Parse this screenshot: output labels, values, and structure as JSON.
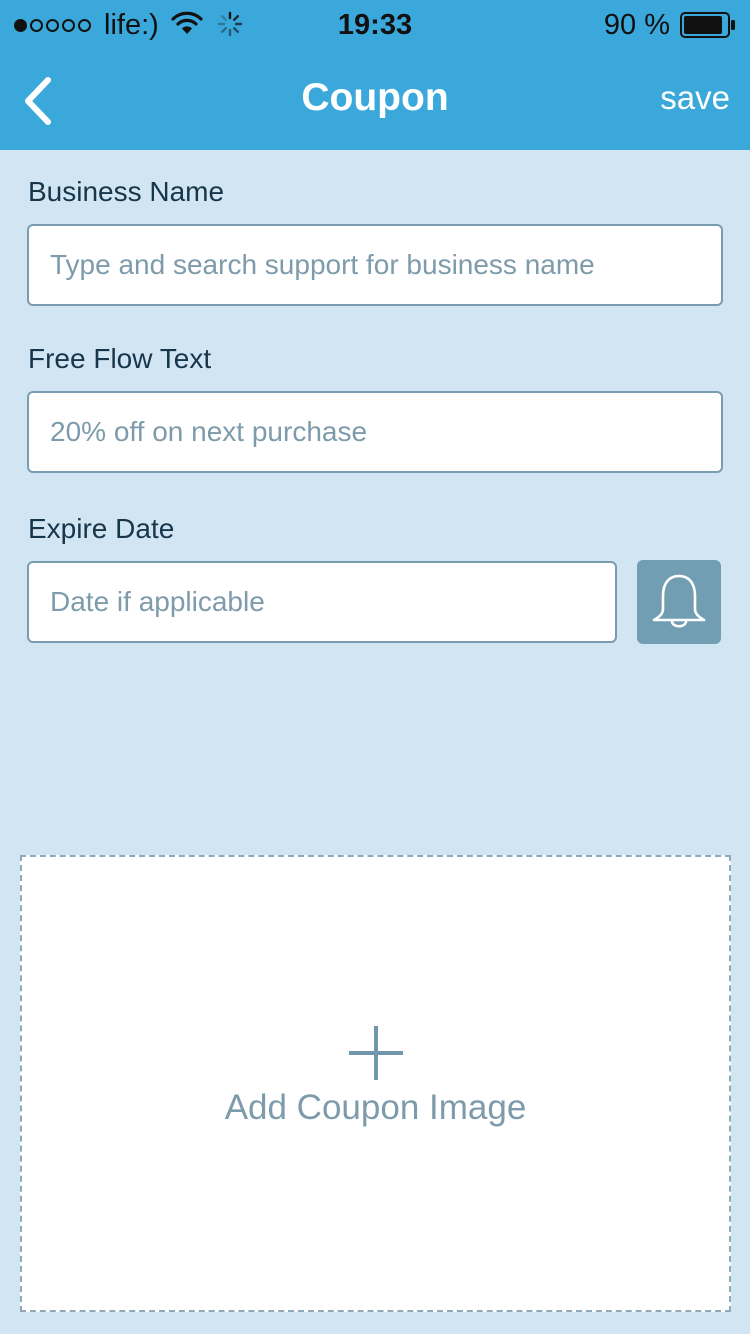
{
  "status_bar": {
    "carrier": "life:)",
    "time": "19:33",
    "battery_percent": "90 %",
    "signal_filled": 1,
    "signal_total": 5,
    "battery_level": 0.9
  },
  "nav": {
    "title": "Coupon",
    "save_label": "save",
    "back_icon": "chevron-left-icon"
  },
  "form": {
    "business_name": {
      "label": "Business Name",
      "placeholder": "Type and search support for business name"
    },
    "free_flow_text": {
      "label": "Free Flow Text",
      "placeholder": "20% off on next purchase"
    },
    "expire_date": {
      "label": "Expire Date",
      "placeholder": "Date if applicable",
      "alarm_icon": "bell-icon"
    }
  },
  "image_upload": {
    "label": "Add Coupon Image",
    "icon": "plus-icon"
  },
  "colors": {
    "header": "#3aa8da",
    "background": "#d2e5f3",
    "field_border": "#7a9cb0",
    "placeholder_text": "#7d9bab",
    "alarm_button": "#729eb4"
  }
}
